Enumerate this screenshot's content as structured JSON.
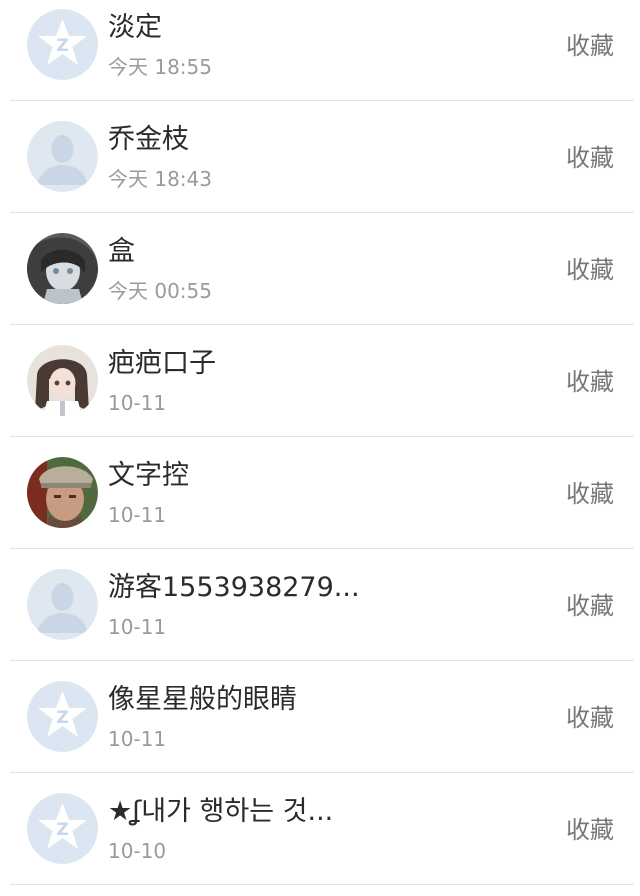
{
  "contacts": [
    {
      "name": "淡定",
      "time": "今天 18:55",
      "action": "收藏",
      "avatar": "qq-logo-avatar"
    },
    {
      "name": "乔金枝",
      "time": "今天 18:43",
      "action": "收藏",
      "avatar": "default-person-avatar"
    },
    {
      "name": "盒",
      "time": "今天 00:55",
      "action": "收藏",
      "avatar": "anime-photo-avatar"
    },
    {
      "name": "疤疤口子",
      "time": "10-11",
      "action": "收藏",
      "avatar": "anime-girl-avatar"
    },
    {
      "name": "文字控",
      "time": "10-11",
      "action": "收藏",
      "avatar": "man-with-cap-photo-avatar"
    },
    {
      "name": "游客1553938279...",
      "time": "10-11",
      "action": "收藏",
      "avatar": "default-person-avatar"
    },
    {
      "name": "像星星般的眼睛",
      "time": "10-11",
      "action": "收藏",
      "avatar": "qq-logo-avatar"
    },
    {
      "name": "★ʆ내가 행하는 것...",
      "time": "10-10",
      "action": "收藏",
      "avatar": "qq-logo-avatar"
    }
  ]
}
